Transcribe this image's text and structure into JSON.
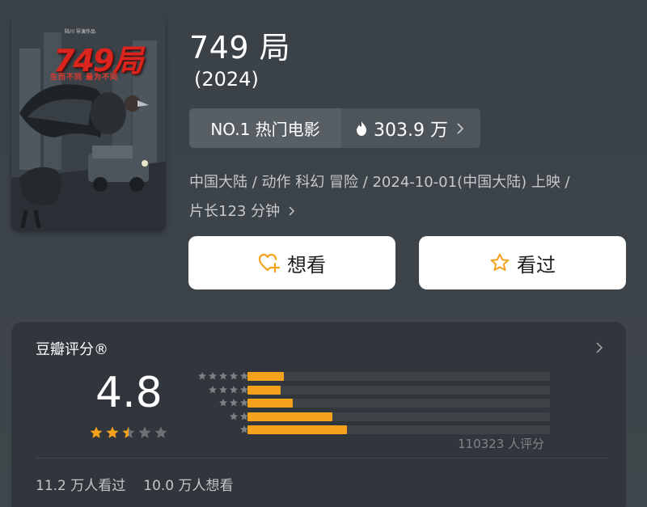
{
  "poster": {
    "title_text": "749局",
    "top_caption": "陆川 导演作品",
    "tagline": "生而不同 最为不同"
  },
  "movie": {
    "title": "749 局",
    "year": "(2024)",
    "rank_label": "NO.1 热门电影",
    "heat_value": "303.9 万",
    "meta_line1": "中国大陆 / 动作 科幻 冒险 / 2024-10-01(中国大陆) 上映 /",
    "meta_line2": "片长123 分钟"
  },
  "actions": {
    "want_label": "想看",
    "seen_label": "看过"
  },
  "rating": {
    "label": "豆瓣评分®",
    "score": "4.8",
    "score_stars": 2.5,
    "distribution": [
      {
        "stars": 5,
        "fraction": 0.12
      },
      {
        "stars": 4,
        "fraction": 0.11
      },
      {
        "stars": 3,
        "fraction": 0.15
      },
      {
        "stars": 2,
        "fraction": 0.28
      },
      {
        "stars": 1,
        "fraction": 0.33
      }
    ],
    "count_text": "110323 人评分",
    "seen_text": "11.2 万人看过",
    "want_text": "10.0 万人想看"
  },
  "colors": {
    "accent": "#f4a11b",
    "background": "#3b4348",
    "card": "#30363b"
  },
  "icons": {
    "want": "heart-plus-icon",
    "seen": "star-outline-icon",
    "heat": "flame-icon"
  }
}
